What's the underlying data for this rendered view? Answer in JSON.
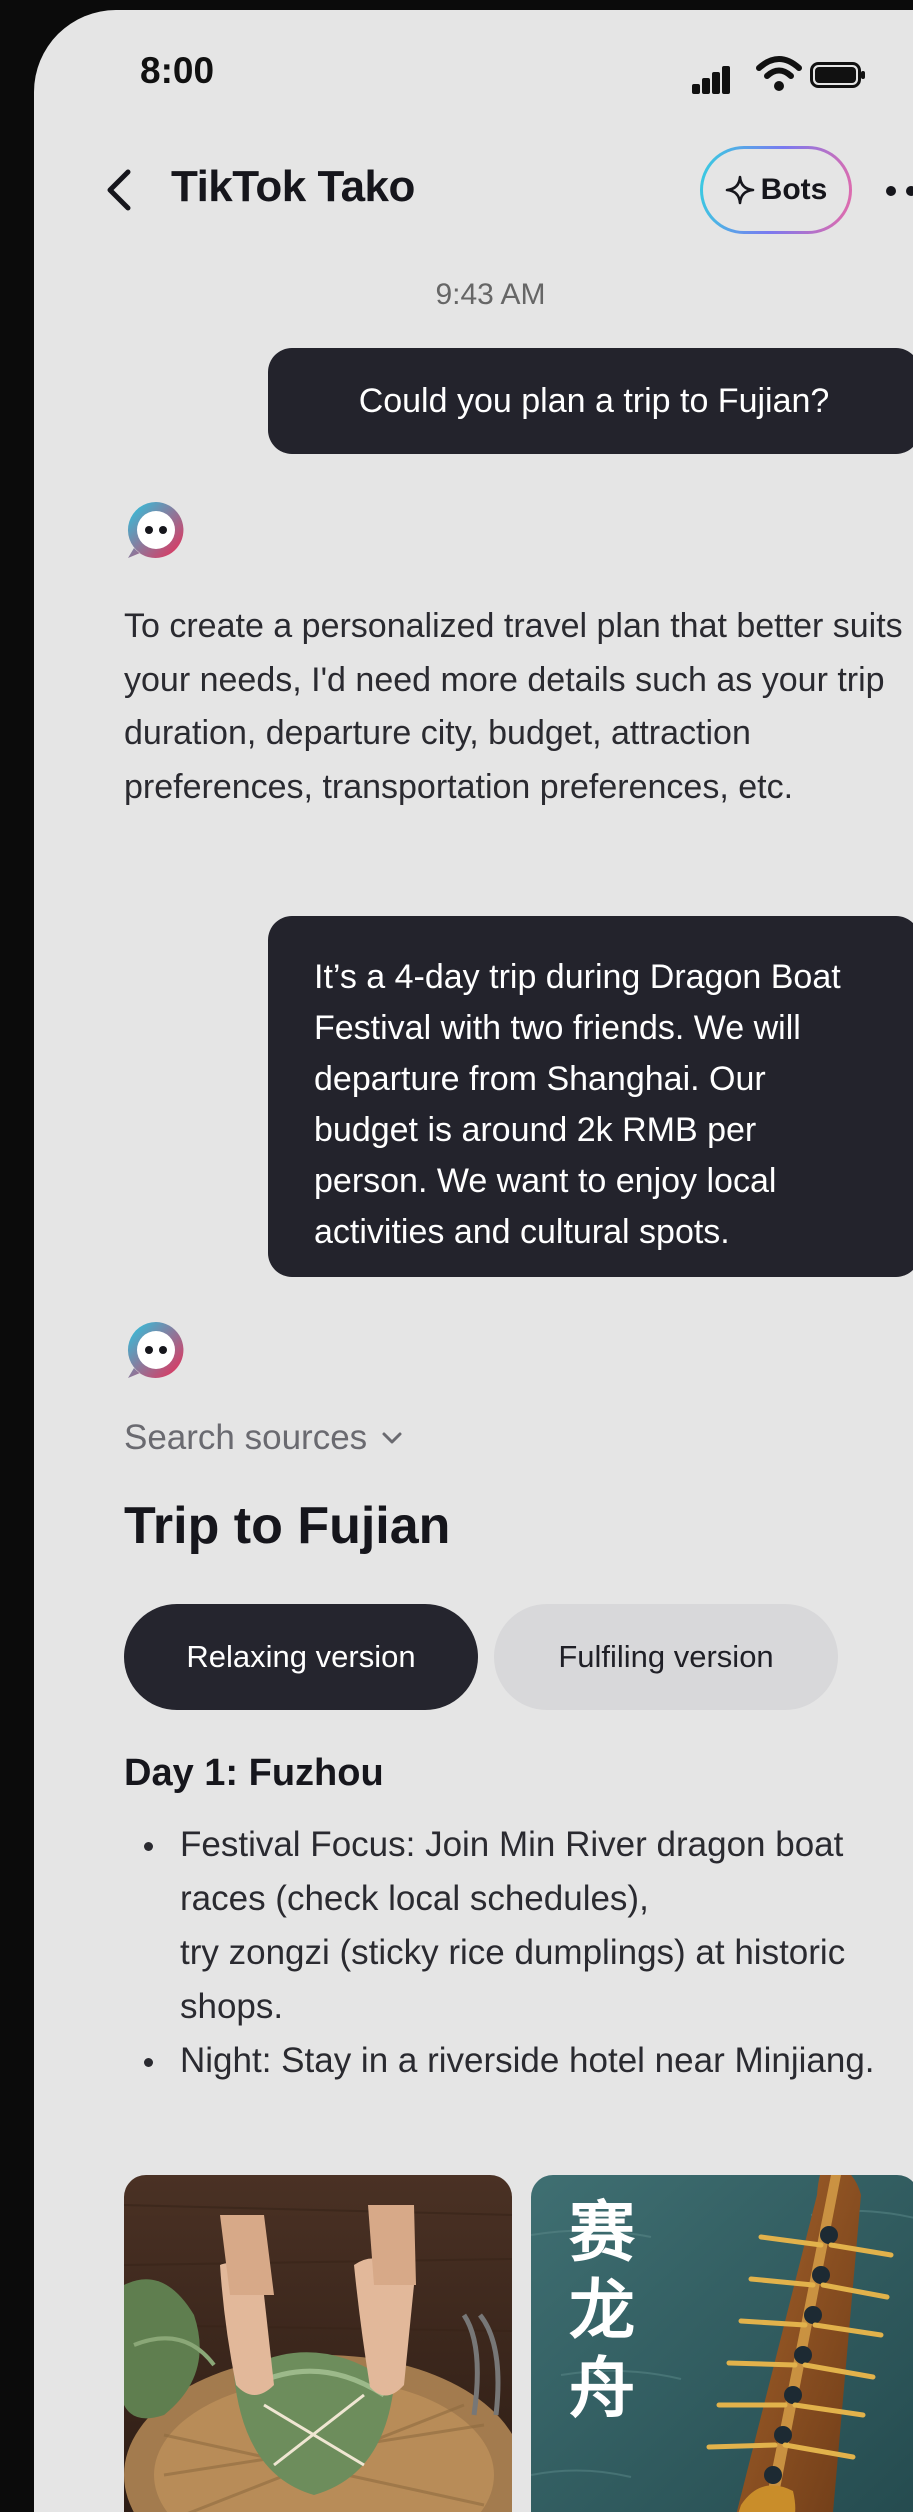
{
  "status_bar": {
    "time": "8:00"
  },
  "header": {
    "title": "TikTok Tako",
    "bots_label": "Bots"
  },
  "chat": {
    "timestamp": "9:43 AM",
    "user_message_1": "Could you plan a trip to Fujian?",
    "bot_message_1": "To create a personalized travel plan that better suits your needs, I'd need more details such as your trip duration, departure city, budget, attraction preferences, transportation preferences, etc.",
    "user_message_2": "It’s a 4-day trip during Dragon Boat Festival with two friends. We will departure from Shanghai. Our budget is around 2k RMB per person. We want to enjoy local activities and cultural spots.",
    "search_sources": "Search sources",
    "plan_title": "Trip to Fujian",
    "versions": [
      "Relaxing version",
      "Fulfiling version"
    ],
    "day1": {
      "title": "Day 1: Fuzhou",
      "bullets": [
        {
          "line_a": "Festival Focus: Join Min River dragon boat races (check local schedules),",
          "line_b": "try zongzi (sticky rice dumplings) at historic shops."
        },
        {
          "line_a": "Night: Stay in a riverside hotel near Minjiang."
        }
      ]
    },
    "image_2_caption": "赛龙舟"
  },
  "colors": {
    "background": "#e5e5e5",
    "user_bubble": "#23232c",
    "selected_pill": "#25252e",
    "unselected_pill": "#d8d8da"
  }
}
